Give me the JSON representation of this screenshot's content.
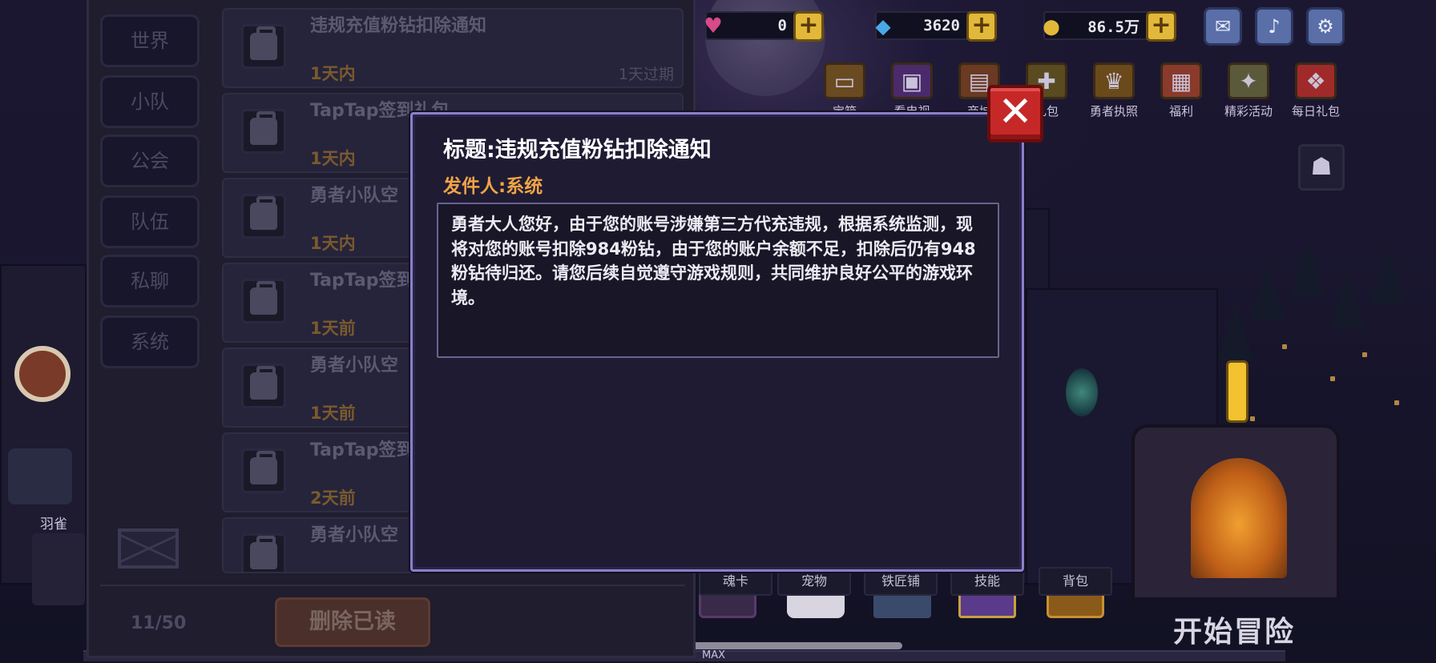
{
  "resources": {
    "heart_value": "0",
    "diamond_value": "3620",
    "gold_value": "86.5万"
  },
  "feature_icons": [
    "宝箱",
    "看电视",
    "商城",
    "礼包",
    "勇者执照",
    "福利",
    "精彩活动",
    "每日礼包"
  ],
  "mail_tabs": [
    "世界",
    "小队",
    "公会",
    "队伍",
    "私聊",
    "系统"
  ],
  "mail_list": [
    {
      "title": "违规充值粉钻扣除通知",
      "time": "1天内",
      "expire": "1天过期"
    },
    {
      "title": "TapTap签到礼包",
      "time": "1天内",
      "expire": ""
    },
    {
      "title": "勇者小队空",
      "time": "1天内",
      "expire": ""
    },
    {
      "title": "TapTap签到",
      "time": "1天前",
      "expire": ""
    },
    {
      "title": "勇者小队空",
      "time": "1天前",
      "expire": ""
    },
    {
      "title": "TapTap签到",
      "time": "2天前",
      "expire": ""
    },
    {
      "title": "勇者小队空",
      "time": "",
      "expire": ""
    }
  ],
  "mail_count": "11/50",
  "delete_read_label": "删除已读",
  "modal": {
    "title": "标题:违规充值粉钻扣除通知",
    "sender": "发件人:系统",
    "body": "勇者大人您好，由于您的账号涉嫌第三方代充违规，根据系统监测，现将对您的账号扣除984粉钻，由于您的账户余额不足，扣除后仍有948粉钻待归还。请您后续自觉遵守游戏规则，共同维护良好公平的游戏环境。",
    "close": "✕"
  },
  "bottom_bar": [
    "魂卡",
    "宠物",
    "铁匠铺",
    "技能",
    "背包"
  ],
  "start_adventure": "开始冒险",
  "character_name": "羽雀",
  "max_label": "MAX",
  "colors": {
    "modal_border": "#8a80c8",
    "sender_orange": "#f0a446",
    "close_red": "#c62828",
    "plus_gold": "#e2b83a"
  },
  "icons": {
    "heart": "heart-icon",
    "diamond": "diamond-icon",
    "gold": "gold-coin-icon",
    "mail": "mail-icon",
    "sound": "sound-icon",
    "settings": "gear-icon"
  }
}
